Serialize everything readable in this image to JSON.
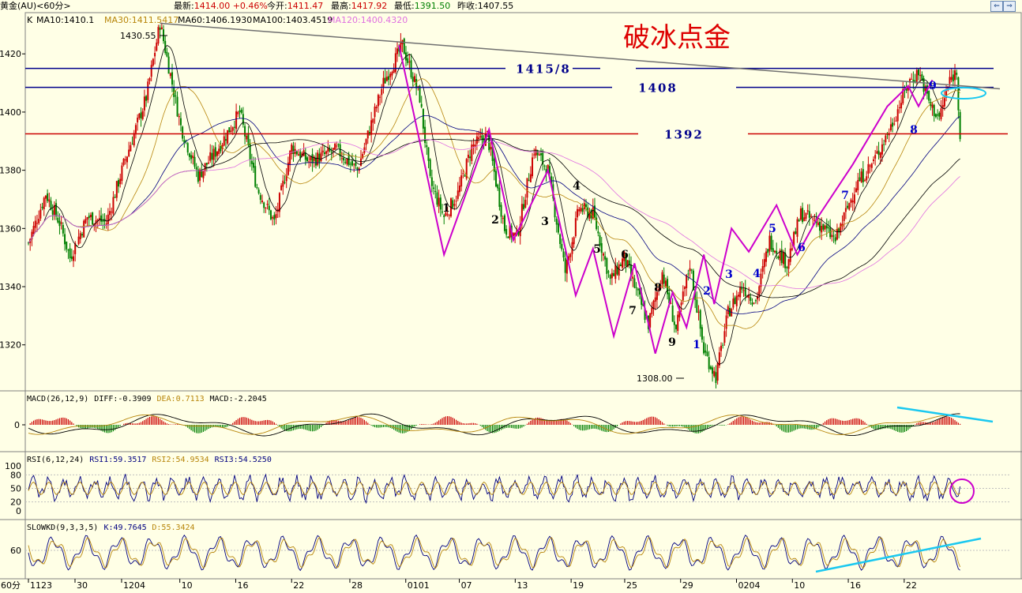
{
  "header": {
    "symbol": "黄金(AU)<60分>",
    "latest_label": "最新:",
    "latest": "1414.00",
    "change": "+0.46%",
    "open_label": "今开:",
    "open": "1411.47",
    "high_label": "最高:",
    "high": "1417.92",
    "low_label": "最低:",
    "low": "1391.50",
    "prev_label": "昨收:",
    "prev": "1407.55"
  },
  "ma_legend": [
    {
      "text": "K",
      "color": "#000000"
    },
    {
      "text": "MA10:1410.1",
      "color": "#000000"
    },
    {
      "text": "MA30:1411.5417",
      "color": "#b8860b"
    },
    {
      "text": "MA60:1406.1930",
      "color": "#000000"
    },
    {
      "text": "MA100:1403.4519",
      "color": "#000000"
    },
    {
      "text": "MA120:1400.4320",
      "color": "#e070e0"
    }
  ],
  "annotation_title": "破冰点金",
  "levels": [
    {
      "label": "1415/8",
      "price": 1415,
      "color": "#00008b"
    },
    {
      "label": "1408",
      "price": 1408.5,
      "color": "#00008b"
    },
    {
      "label": "1392",
      "price": 1392.5,
      "color": "#cc0000"
    }
  ],
  "price_marks": {
    "high": "1430.55",
    "low": "1308.00"
  },
  "wave_labels_black": [
    "1",
    "2",
    "3",
    "4",
    "5",
    "6",
    "7",
    "8",
    "9"
  ],
  "wave_labels_blue": [
    "1",
    "2",
    "3",
    "4",
    "5",
    "6",
    "7",
    "8",
    "9"
  ],
  "chart_data": {
    "type": "candlestick",
    "main": {
      "ylim": [
        1305,
        1432
      ],
      "yticks": [
        1320,
        1340,
        1360,
        1380,
        1400,
        1420
      ],
      "path": [
        [
          0,
          1355
        ],
        [
          10,
          1372
        ],
        [
          18,
          1362
        ],
        [
          24,
          1350
        ],
        [
          34,
          1364
        ],
        [
          45,
          1362
        ],
        [
          55,
          1382
        ],
        [
          68,
          1405
        ],
        [
          76,
          1430.5
        ],
        [
          88,
          1395
        ],
        [
          98,
          1378
        ],
        [
          110,
          1388
        ],
        [
          122,
          1400
        ],
        [
          132,
          1374
        ],
        [
          142,
          1362
        ],
        [
          152,
          1388
        ],
        [
          162,
          1383
        ],
        [
          178,
          1387
        ],
        [
          190,
          1380
        ],
        [
          205,
          1410
        ],
        [
          216,
          1423
        ],
        [
          226,
          1405
        ],
        [
          232,
          1376
        ],
        [
          240,
          1364
        ],
        [
          248,
          1372
        ],
        [
          256,
          1388
        ],
        [
          265,
          1392
        ],
        [
          275,
          1360
        ],
        [
          282,
          1357
        ],
        [
          292,
          1387
        ],
        [
          300,
          1380
        ],
        [
          310,
          1345
        ],
        [
          318,
          1367
        ],
        [
          326,
          1365
        ],
        [
          336,
          1342
        ],
        [
          344,
          1350
        ],
        [
          358,
          1327
        ],
        [
          366,
          1345
        ],
        [
          374,
          1325
        ],
        [
          382,
          1348
        ],
        [
          390,
          1318
        ],
        [
          397,
          1309
        ],
        [
          404,
          1331
        ],
        [
          412,
          1340
        ],
        [
          420,
          1335
        ],
        [
          428,
          1356
        ],
        [
          438,
          1348
        ],
        [
          446,
          1365
        ],
        [
          456,
          1362
        ],
        [
          466,
          1356
        ],
        [
          478,
          1375
        ],
        [
          488,
          1383
        ],
        [
          498,
          1395
        ],
        [
          508,
          1410
        ],
        [
          514,
          1414
        ],
        [
          521,
          1402
        ],
        [
          526,
          1398
        ],
        [
          532,
          1411
        ],
        [
          536,
          1414
        ],
        [
          538,
          1392
        ]
      ],
      "x_labels": [
        "1123",
        "30",
        "1204",
        "10",
        "16",
        "22",
        "28",
        "0101",
        "07",
        "13",
        "19",
        "25",
        "29",
        "0204",
        "10",
        "16",
        "22"
      ],
      "x_label_pos": [
        0,
        20,
        40,
        65,
        89,
        113,
        138,
        162,
        185,
        209,
        233,
        256,
        280,
        304,
        328,
        352,
        376
      ]
    },
    "macd": {
      "title": "MACD(26,12,9)",
      "diff": "DIFF:-0.3909",
      "dea": "DEA:0.7113",
      "macd": "MACD:-2.2045",
      "yticks": [
        0
      ]
    },
    "rsi": {
      "title": "RSI(6,12,24)",
      "rsi1": "RSI1:59.3517",
      "rsi2": "RSI2:54.9534",
      "rsi3": "RSI3:54.5250",
      "yticks": [
        100,
        80,
        50,
        20,
        0
      ]
    },
    "kd": {
      "title": "SLOWKD(9,3,3,5)",
      "k": "K:49.7645",
      "d": "D:55.3424",
      "yticks": [
        60
      ]
    }
  },
  "period_label": "60分"
}
